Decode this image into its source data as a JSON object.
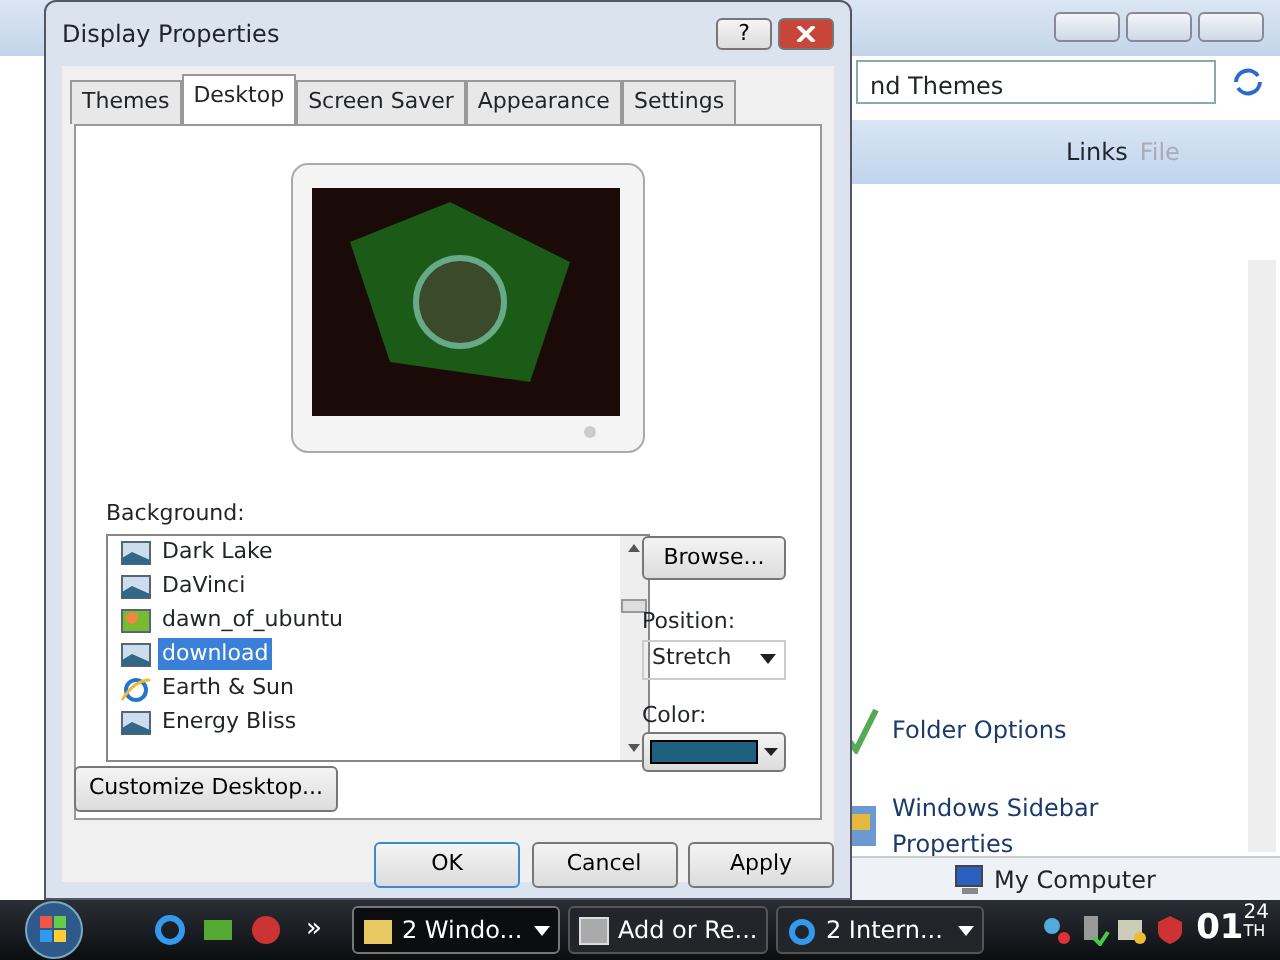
{
  "background_window": {
    "address": "nd Themes",
    "links": "Links",
    "menu": "File",
    "items": [
      {
        "label": "Folder Options",
        "kind": "folder"
      },
      {
        "label": "Windows Sidebar Properties",
        "kind": "sidebar"
      }
    ],
    "status": "My Computer"
  },
  "dialog": {
    "title": "Display Properties",
    "help": "?",
    "tabs": [
      {
        "label": "Themes",
        "selected": false
      },
      {
        "label": "Desktop",
        "selected": true
      },
      {
        "label": "Screen Saver",
        "selected": false
      },
      {
        "label": "Appearance",
        "selected": false
      },
      {
        "label": "Settings",
        "selected": false
      }
    ],
    "background_label": "Background:",
    "wallpapers": [
      {
        "name": "Dark Lake",
        "kind": "image",
        "selected": false
      },
      {
        "name": "DaVinci",
        "kind": "image",
        "selected": false
      },
      {
        "name": "dawn_of_ubuntu",
        "kind": "photo",
        "selected": false
      },
      {
        "name": "download",
        "kind": "image",
        "selected": true
      },
      {
        "name": "Earth & Sun",
        "kind": "web",
        "selected": false
      },
      {
        "name": "Energy Bliss",
        "kind": "image",
        "selected": false
      }
    ],
    "browse": "Browse...",
    "position_label": "Position:",
    "position": "Stretch",
    "color_label": "Color:",
    "color": "#1f5f80",
    "customize": "Customize Desktop...",
    "buttons": [
      "OK",
      "Cancel",
      "Apply"
    ]
  },
  "taskbar": {
    "more": "»",
    "tasks": [
      {
        "label": "2 Windo...",
        "kind": "folder",
        "selected": true,
        "dropdown": true
      },
      {
        "label": "Add or Re...",
        "kind": "app",
        "selected": false,
        "dropdown": false
      },
      {
        "label": "2 Intern...",
        "kind": "web",
        "selected": false,
        "dropdown": true
      }
    ],
    "clock": {
      "hour": "01",
      "minute": "24",
      "suffix": "TH"
    }
  }
}
